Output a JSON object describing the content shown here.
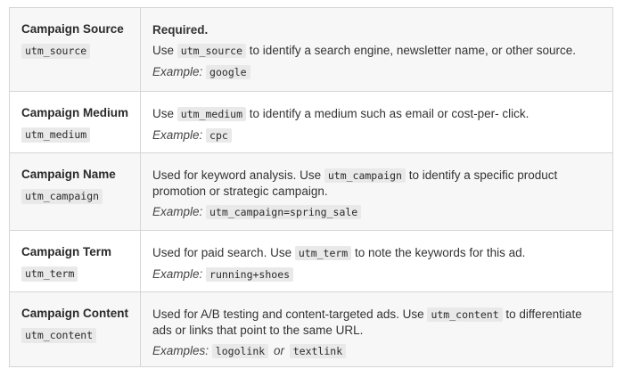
{
  "rows": [
    {
      "name": "Campaign Source",
      "param": "utm_source",
      "required": "Required.",
      "desc_pre": "Use",
      "desc_code": "utm_source",
      "desc_post": "to identify a search engine, newsletter name, or other source.",
      "example_label": "Example:",
      "example_value": "google"
    },
    {
      "name": "Campaign Medium",
      "param": "utm_medium",
      "desc_pre": "Use",
      "desc_code": "utm_medium",
      "desc_post": "to identify a medium such as email or cost-per- click.",
      "example_label": "Example:",
      "example_value": "cpc"
    },
    {
      "name": "Campaign Name",
      "param": "utm_campaign",
      "desc_pre": "Used for keyword analysis. Use",
      "desc_code": "utm_campaign",
      "desc_post": "to identify a specific product",
      "desc_line2": "promotion or strategic campaign.",
      "example_label": "Example:",
      "example_value": "utm_campaign=spring_sale"
    },
    {
      "name": "Campaign Term",
      "param": "utm_term",
      "desc_pre": "Used for paid search. Use",
      "desc_code": "utm_term",
      "desc_post": "to note the keywords for this ad.",
      "example_label": "Example:",
      "example_value": "running+shoes"
    },
    {
      "name": "Campaign Content",
      "param": "utm_content",
      "desc_pre": "Used for A/B testing and content-targeted ads. Use",
      "desc_code": "utm_content",
      "desc_post": "to differentiate",
      "desc_line2": "ads or links that point to the same URL.",
      "example_label": "Examples:",
      "example_value": "logolink",
      "example_or": "or",
      "example_value2": "textlink"
    }
  ]
}
